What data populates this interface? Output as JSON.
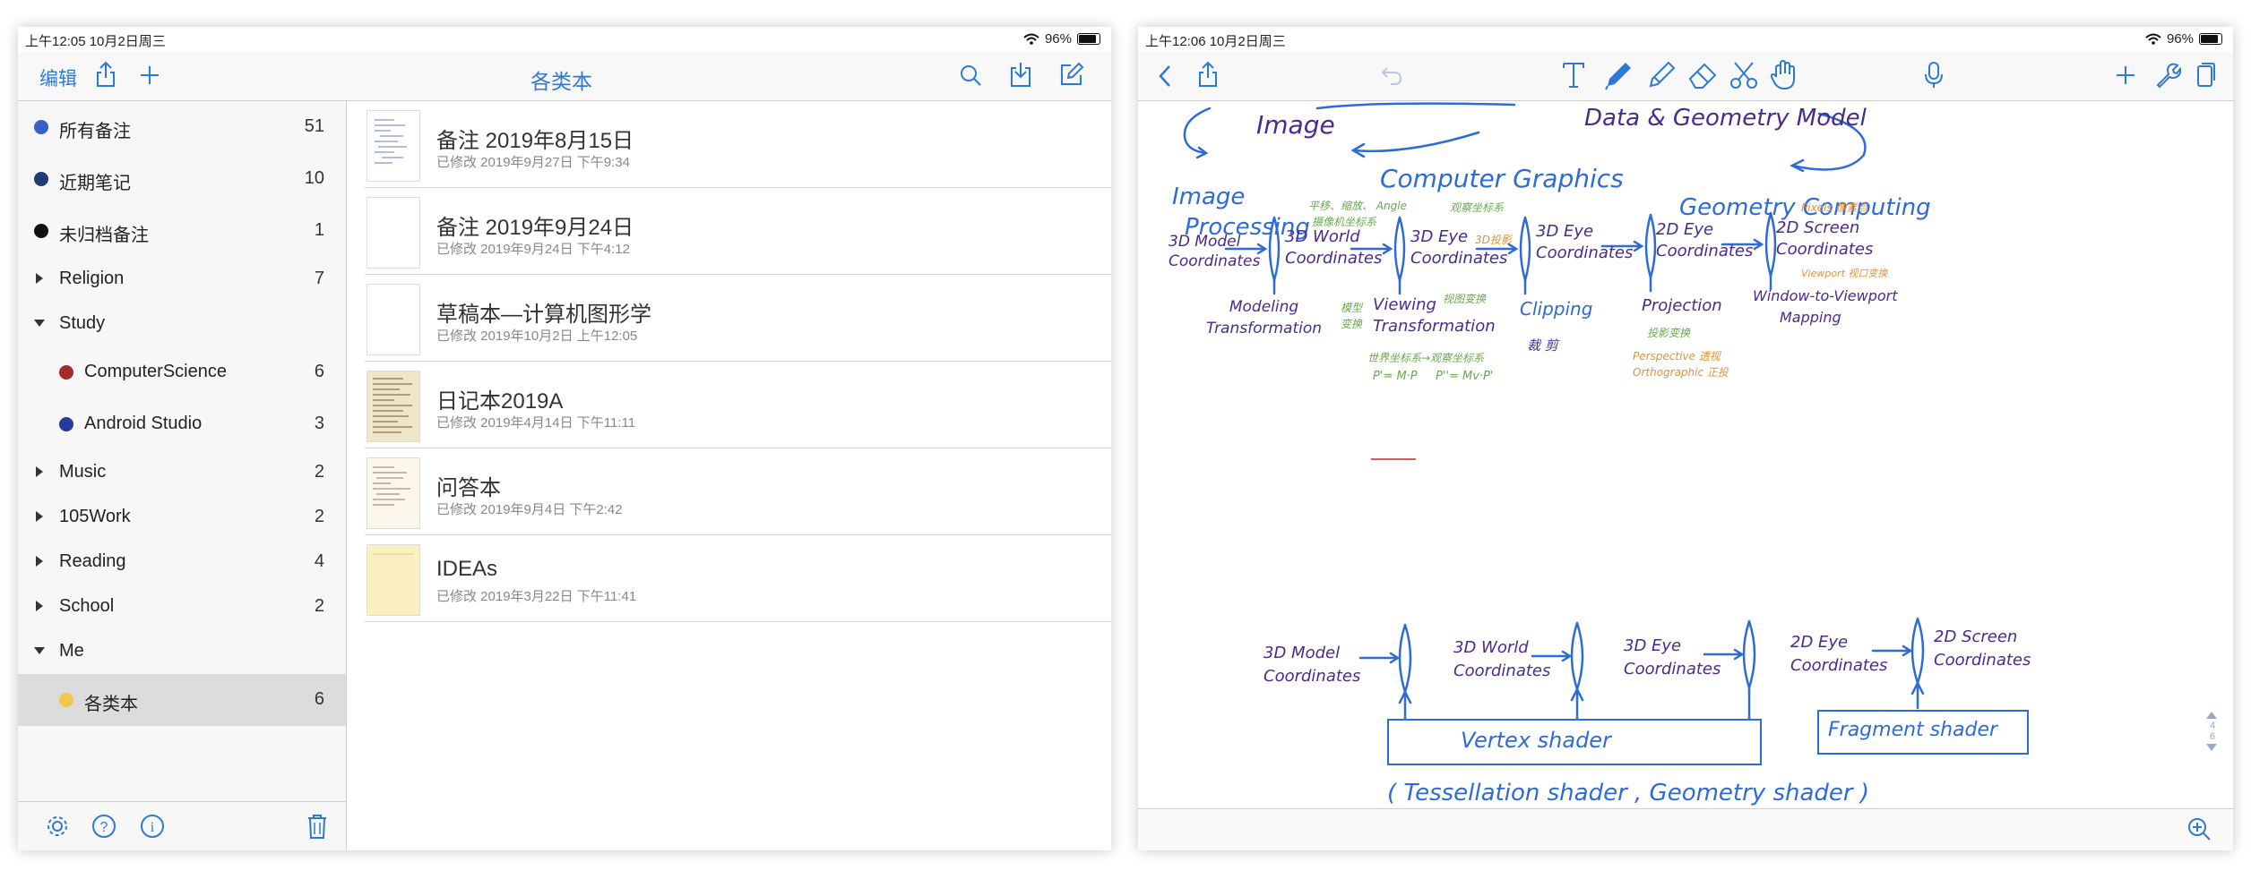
{
  "colors": {
    "accent": "#2d7ad6",
    "ink_blue": "#2d6bd6",
    "ink_purple": "#4b2a8f",
    "ink_green": "#6aa84f",
    "ink_orange": "#e69138",
    "ink_red": "#cc2222"
  },
  "left": {
    "status": {
      "time": "上午12:05  10月2日周三",
      "battery": "96%",
      "battery_level": 0.96
    },
    "nav": {
      "edit": "编辑",
      "title": "各类本",
      "icons": [
        "share-icon",
        "plus-icon",
        "search-icon",
        "import-icon",
        "compose-icon"
      ]
    },
    "sidebar": {
      "items": [
        {
          "label": "所有备注",
          "count": "51",
          "color": "#3a5fc8"
        },
        {
          "label": "近期笔记",
          "count": "10",
          "color": "#1f3a78"
        },
        {
          "label": "未归档备注",
          "count": "1",
          "color": "#111111"
        },
        {
          "label": "Religion",
          "count": "7"
        },
        {
          "label": "Study",
          "count": ""
        },
        {
          "label": "ComputerScience",
          "count": "6",
          "color": "#a52a2a"
        },
        {
          "label": "Android Studio",
          "count": "3",
          "color": "#2a3a9a"
        },
        {
          "label": "Music",
          "count": "2"
        },
        {
          "label": "105Work",
          "count": "2"
        },
        {
          "label": "Reading",
          "count": "4"
        },
        {
          "label": "School",
          "count": "2"
        },
        {
          "label": "Me",
          "count": ""
        },
        {
          "label": "各类本",
          "count": "6",
          "color": "#f2c84b"
        }
      ],
      "footer_icons": [
        "settings-icon",
        "help-icon",
        "info-icon",
        "trash-icon"
      ]
    },
    "notes": [
      {
        "title": "备注 2019年8月15日",
        "date": "已修改 2019年9月27日 下午9:34"
      },
      {
        "title": "备注 2019年9月24日",
        "date": "已修改 2019年9月24日 下午4:12"
      },
      {
        "title": "草稿本—计算机图形学",
        "date": "已修改 2019年10月2日 上午12:05"
      },
      {
        "title": "日记本2019A",
        "date": "已修改 2019年4月14日 下午11:11"
      },
      {
        "title": "问答本",
        "date": "已修改 2019年9月4日 下午2:42"
      },
      {
        "title": "IDEAs",
        "date": "已修改 2019年3月22日 下午11:41"
      }
    ]
  },
  "right": {
    "status": {
      "time": "上午12:06  10月2日周三",
      "battery": "96%",
      "battery_level": 0.96
    },
    "toolbar_icons": [
      "back-icon",
      "share-icon",
      "undo-icon",
      "text-tool-icon",
      "pen-icon",
      "highlighter-icon",
      "eraser-icon",
      "scissors-icon",
      "hand-icon",
      "microphone-icon",
      "plus-icon",
      "wrench-icon",
      "pages-icon"
    ],
    "page_indicator": {
      "current": "4",
      "total": "6"
    },
    "canvas": {
      "top": {
        "image": "Image",
        "data_model": "Data & Geometry Model",
        "computer_graphics": "Computer Graphics",
        "image_processing_1": "Image",
        "image_processing_2": "Processing",
        "geometry_computing": "Geometry  Computing"
      },
      "pipeline": {
        "stage1": [
          "3D Model",
          "Coordinates"
        ],
        "stage2": [
          "3D World",
          "Coordinates"
        ],
        "stage3": [
          "3D Eye",
          "Coordinates"
        ],
        "stage4": [
          "3D Eye",
          "Coordinates"
        ],
        "stage5": [
          "2D Eye",
          "Coordinates"
        ],
        "stage6": [
          "2D Screen",
          "Coordinates"
        ],
        "t1": [
          "Modeling",
          "Transformation"
        ],
        "t2": [
          "Viewing",
          "Transformation"
        ],
        "t3": "Clipping",
        "t4": "Projection",
        "t5": [
          "Window-to-Viewport",
          "Mapping"
        ],
        "notes": {
          "n1": "平移、缩放、 Angle",
          "n2": "摄像机坐标系",
          "n3": "观察坐标系",
          "n4": "3D投影",
          "n5": "Pixels 像素点",
          "n6": "模型 变换",
          "n7": "视图变换",
          "n8": "世界坐标系→观察坐标系",
          "n9": "P'= M·P",
          "n10": "P''= Mv·P'",
          "n11": "裁 剪",
          "n12": "投影变换",
          "n13": "Perspective 透视",
          "n14": "Orthographic 正投",
          "n15": "Viewport 视口变换"
        }
      },
      "shader": {
        "s1": [
          "3D Model",
          "Coordinates"
        ],
        "s2": [
          "3D World",
          "Coordinates"
        ],
        "s3": [
          "3D Eye",
          "Coordinates"
        ],
        "s4": [
          "2D Eye",
          "Coordinates"
        ],
        "s5": [
          "2D Screen",
          "Coordinates"
        ],
        "vertex": "Vertex     shader",
        "fragment": "Fragment  shader",
        "optional": "( Tessellation  shader ,    Geometry  shader )"
      }
    }
  }
}
